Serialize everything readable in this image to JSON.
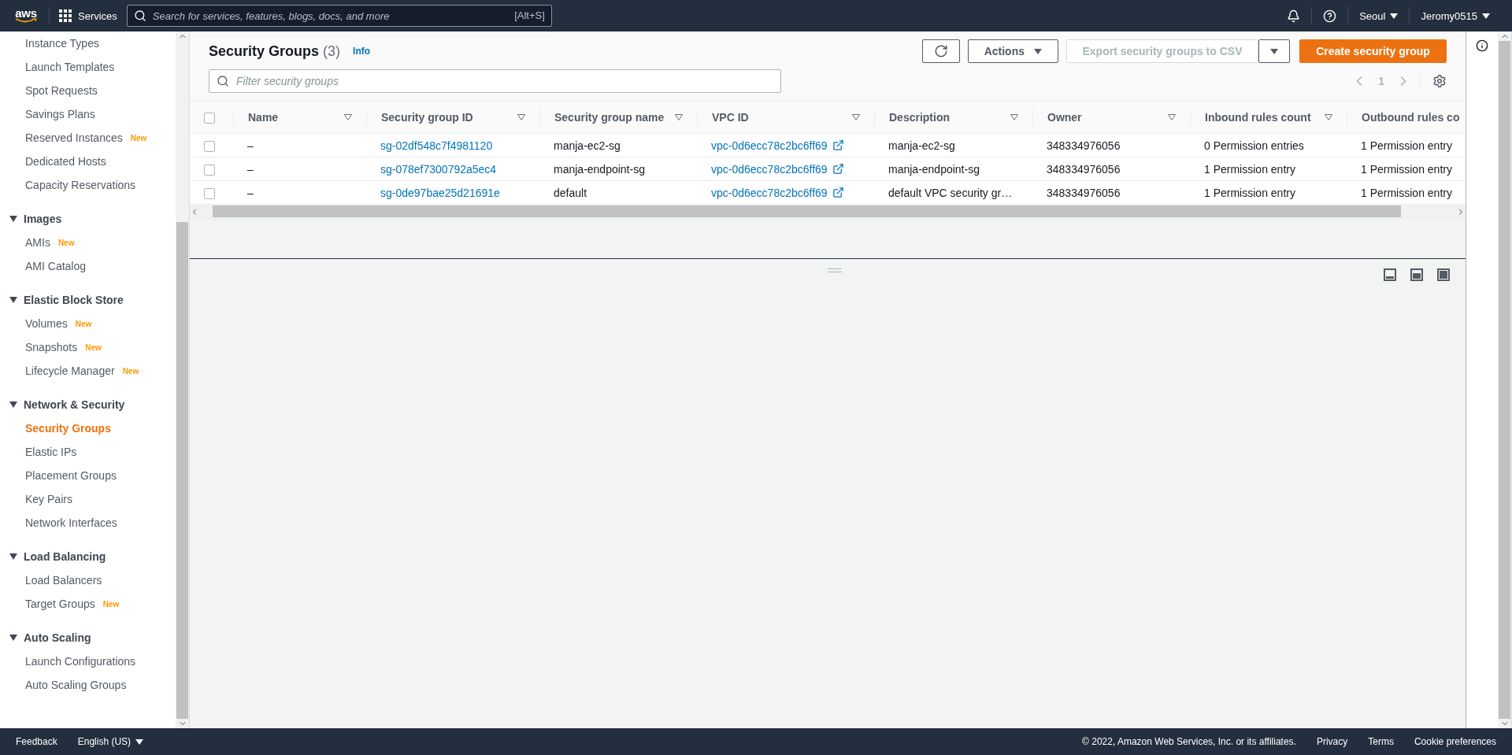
{
  "top_bar": {
    "logo": "aws",
    "services": "Services",
    "search": {
      "placeholder": "Search for services, features, blogs, docs, and more",
      "shortcut": "[Alt+S]"
    },
    "region": "Seoul",
    "user": "Jeromy0515"
  },
  "sidebar": {
    "groups": [
      {
        "items": [
          {
            "label": "Instance Types",
            "selected": false
          },
          {
            "label": "Launch Templates",
            "selected": false
          },
          {
            "label": "Spot Requests",
            "selected": false
          },
          {
            "label": "Savings Plans",
            "selected": false
          },
          {
            "label": "Reserved Instances",
            "badge": "New",
            "selected": false
          },
          {
            "label": "Dedicated Hosts",
            "selected": false
          },
          {
            "label": "Capacity Reservations",
            "selected": false
          }
        ]
      },
      {
        "title": "Images",
        "expanded": true,
        "items": [
          {
            "label": "AMIs",
            "badge": "New",
            "selected": false
          },
          {
            "label": "AMI Catalog",
            "selected": false
          }
        ]
      },
      {
        "title": "Elastic Block Store",
        "expanded": true,
        "items": [
          {
            "label": "Volumes",
            "badge": "New",
            "selected": false
          },
          {
            "label": "Snapshots",
            "badge": "New",
            "selected": false
          },
          {
            "label": "Lifecycle Manager",
            "badge": "New",
            "selected": false
          }
        ]
      },
      {
        "title": "Network & Security",
        "expanded": true,
        "items": [
          {
            "label": "Security Groups",
            "selected": true
          },
          {
            "label": "Elastic IPs",
            "selected": false
          },
          {
            "label": "Placement Groups",
            "selected": false
          },
          {
            "label": "Key Pairs",
            "selected": false
          },
          {
            "label": "Network Interfaces",
            "selected": false
          }
        ]
      },
      {
        "title": "Load Balancing",
        "expanded": true,
        "items": [
          {
            "label": "Load Balancers",
            "selected": false
          },
          {
            "label": "Target Groups",
            "badge": "New",
            "selected": false
          }
        ]
      },
      {
        "title": "Auto Scaling",
        "expanded": true,
        "items": [
          {
            "label": "Launch Configurations",
            "selected": false
          },
          {
            "label": "Auto Scaling Groups",
            "selected": false
          }
        ]
      }
    ]
  },
  "panel": {
    "title": "Security Groups",
    "count": "(3)",
    "info": "Info",
    "buttons": [
      {
        "kind": "refresh"
      },
      {
        "kind": "dropdown",
        "label": "Actions"
      },
      {
        "kind": "split",
        "label": "Export security groups to CSV",
        "disabled": true
      },
      {
        "kind": "primary",
        "label": "Create security group"
      }
    ],
    "filter": {
      "placeholder": "Filter security groups"
    },
    "page": "1"
  },
  "table": {
    "all_checked": false,
    "columns": [
      {
        "label": "Name"
      },
      {
        "label": "Security group ID"
      },
      {
        "label": "Security group name"
      },
      {
        "label": "VPC ID"
      },
      {
        "label": "Description"
      },
      {
        "label": "Owner"
      },
      {
        "label": "Inbound rules count"
      },
      {
        "label": "Outbound rules co"
      }
    ],
    "rows": [
      {
        "checked": false,
        "cells": [
          "–",
          "sg-02df548c7f4981120",
          "manja-ec2-sg",
          "vpc-0d6ecc78c2bc6ff69",
          "manja-ec2-sg",
          "348334976056",
          "0 Permission entries",
          "1 Permission entry"
        ]
      },
      {
        "checked": false,
        "cells": [
          "–",
          "sg-078ef7300792a5ec4",
          "manja-endpoint-sg",
          "vpc-0d6ecc78c2bc6ff69",
          "manja-endpoint-sg",
          "348334976056",
          "1 Permission entry",
          "1 Permission entry"
        ]
      },
      {
        "checked": false,
        "cells": [
          "–",
          "sg-0de97bae25d21691e",
          "default",
          "vpc-0d6ecc78c2bc6ff69",
          "default VPC security gr…",
          "348334976056",
          "1 Permission entry",
          "1 Permission entry"
        ]
      }
    ]
  },
  "footer": {
    "feedback": "Feedback",
    "language": "English (US)",
    "copyright": "© 2022, Amazon Web Services, Inc. or its affiliates.",
    "links": [
      "Privacy",
      "Terms",
      "Cookie preferences"
    ]
  }
}
